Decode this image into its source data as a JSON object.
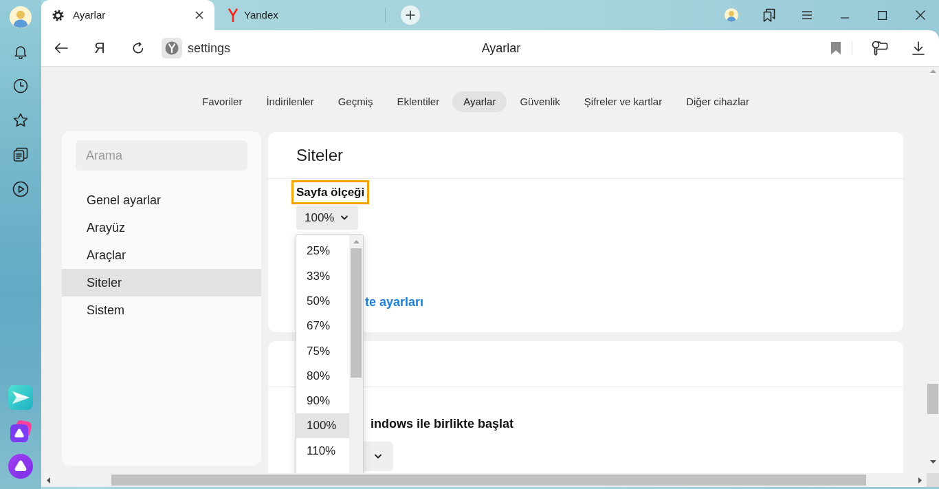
{
  "tabs": [
    {
      "kind": "settings",
      "title": "Ayarlar",
      "selected": true
    },
    {
      "kind": "site",
      "title": "Yandex",
      "selected": false
    }
  ],
  "toolbar": {
    "home_button": "Я",
    "url": "settings",
    "page_title": "Ayarlar"
  },
  "nav": [
    {
      "label": "Favoriler",
      "selected": false
    },
    {
      "label": "İndirilenler",
      "selected": false
    },
    {
      "label": "Geçmiş",
      "selected": false
    },
    {
      "label": "Eklentiler",
      "selected": false
    },
    {
      "label": "Ayarlar",
      "selected": true
    },
    {
      "label": "Güvenlik",
      "selected": false
    },
    {
      "label": "Şifreler ve kartlar",
      "selected": false
    },
    {
      "label": "Diğer cihazlar",
      "selected": false
    }
  ],
  "settings_menu": {
    "search": {
      "placeholder": "Arama"
    },
    "items": [
      {
        "label": "Genel ayarlar",
        "selected": false
      },
      {
        "label": "Arayüz",
        "selected": false
      },
      {
        "label": "Araçlar",
        "selected": false
      },
      {
        "label": "Siteler",
        "selected": true
      },
      {
        "label": "Sistem",
        "selected": false
      }
    ]
  },
  "sections": [
    {
      "title": "Siteler",
      "setting": {
        "label": "Sayfa ölçeği",
        "highlighted": true,
        "value": "100%"
      },
      "link": "te ayarları"
    },
    {
      "setting": {
        "label": "indows ile birlikte başlat",
        "highlighted": false
      }
    }
  ],
  "dropdown": {
    "options": [
      {
        "label": "25%",
        "selected": false
      },
      {
        "label": "33%",
        "selected": false
      },
      {
        "label": "50%",
        "selected": false
      },
      {
        "label": "67%",
        "selected": false
      },
      {
        "label": "75%",
        "selected": false
      },
      {
        "label": "80%",
        "selected": false
      },
      {
        "label": "90%",
        "selected": false
      },
      {
        "label": "100%",
        "selected": true
      },
      {
        "label": "110%",
        "selected": false
      }
    ]
  }
}
